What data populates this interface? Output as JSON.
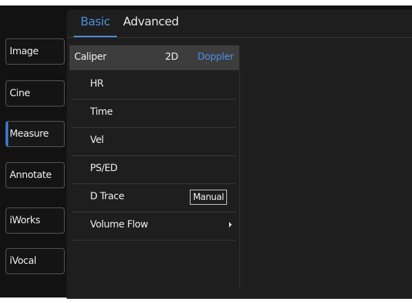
{
  "tabs": [
    {
      "label": "Basic",
      "active": true
    },
    {
      "label": "Advanced",
      "active": false
    }
  ],
  "sidebar": {
    "items": [
      {
        "label": "Image",
        "active": false
      },
      {
        "label": "Cine",
        "active": false
      },
      {
        "label": "Measure",
        "active": true
      },
      {
        "label": "Annotate",
        "active": false
      },
      {
        "label": "iWorks",
        "active": false
      },
      {
        "label": "iVocal",
        "active": false
      }
    ]
  },
  "caliper": {
    "label": "Caliper",
    "options": [
      "2D",
      "Doppler"
    ],
    "selected": "Doppler"
  },
  "measurements": [
    {
      "label": "HR"
    },
    {
      "label": "Time"
    },
    {
      "label": "Vel"
    },
    {
      "label": "PS/ED"
    },
    {
      "label": "D Trace",
      "button": "Manual"
    },
    {
      "label": "Volume Flow",
      "submenu_icon": "chevron-right-icon"
    }
  ],
  "colors": {
    "accent": "#4e8fe0",
    "panel": "#1e1e1e",
    "background": "#121212",
    "selected_row": "#3d3d3d"
  }
}
